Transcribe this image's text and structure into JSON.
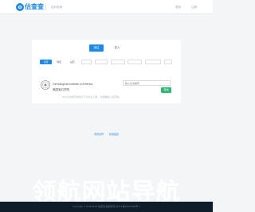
{
  "header": {
    "logo_icon": "o",
    "logo_text": "估查查",
    "nav_label": "估价查询",
    "right_links": [
      "登录",
      "注册"
    ]
  },
  "search_panel": {
    "tabs": [
      {
        "label": "找估",
        "active": true
      },
      {
        "label": "查人",
        "active": false
      }
    ],
    "filter_chips": [
      {
        "label": "全部",
        "active": true
      },
      {
        "label": "珠宝",
        "active": false
      },
      {
        "label": "钻石",
        "active": false
      },
      {
        "label": "",
        "active": false
      },
      {
        "label": "",
        "active": false
      },
      {
        "label": "",
        "active": false
      },
      {
        "label": "",
        "active": false
      },
      {
        "label": "",
        "active": false
      },
      {
        "label": "",
        "active": false
      }
    ],
    "org": {
      "seal_icon": "gia-seal-icon",
      "name": "Gemological Institute of America",
      "subtitle": "美国宝石学院"
    },
    "search": {
      "placeholder": "输入证书编号",
      "button_label": "查询"
    },
    "hint": "GIA证书编号通常位于证书左上角，请准确输入后查询。"
  },
  "footer": {
    "links": [
      "商务合作",
      "友情链接"
    ],
    "watermark": "领航网站导航",
    "copyright": "Copyright © 2016-2023 估查查 版权所有 沪ICP备19045482号-1"
  },
  "colors": {
    "accent": "#1e88e5",
    "search_button": "#2eb872",
    "footer_bg": "#0f1c29",
    "page_bg": "#f3f5f7"
  }
}
